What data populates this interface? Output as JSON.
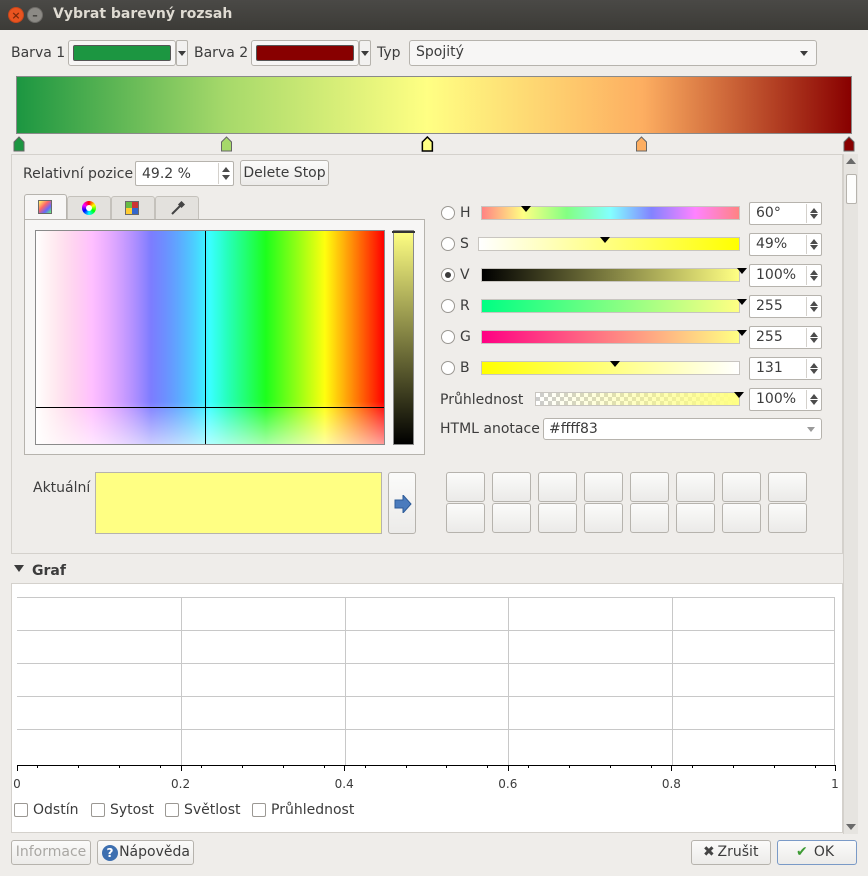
{
  "window": {
    "title": "Vybrat barevný rozsah"
  },
  "top": {
    "color1_label": "Barva 1",
    "color1": "#1c9641",
    "color2_label": "Barva 2",
    "color2": "#880000",
    "type_label": "Typ",
    "type_value": "Spojitý"
  },
  "gradient": {
    "stops": [
      "#1c9641",
      "#a6d96a",
      "#ffff83",
      "#fdae61",
      "#880000"
    ]
  },
  "position": {
    "label": "Relativní pozice",
    "value": "49.2 %",
    "delete_label": "Delete Stop"
  },
  "picker": {
    "tabs": [
      "palette-icon",
      "color-wheel-icon",
      "swatch-grid-icon",
      "eyedropper-icon"
    ],
    "channels": [
      {
        "key": "H",
        "value": "60°",
        "selected": false
      },
      {
        "key": "S",
        "value": "49%",
        "selected": false
      },
      {
        "key": "V",
        "value": "100%",
        "selected": true
      },
      {
        "key": "R",
        "value": "255",
        "selected": false
      },
      {
        "key": "G",
        "value": "255",
        "selected": false
      },
      {
        "key": "B",
        "value": "131",
        "selected": false
      }
    ],
    "opacity_label": "Průhlednost",
    "opacity_value": "100%",
    "html_label": "HTML anotace",
    "html_value": "#ffff83",
    "current_label": "Aktuální",
    "current_color": "#ffff83"
  },
  "graph": {
    "section_label": "Graf",
    "x_ticks": [
      "0",
      "0.2",
      "0.4",
      "0.6",
      "0.8",
      "1"
    ],
    "checks": [
      "Odstín",
      "Sytost",
      "Světlost",
      "Průhlednost"
    ]
  },
  "footer": {
    "info_label": "Informace",
    "help_label": "Nápověda",
    "cancel_label": "Zrušit",
    "ok_label": "OK"
  }
}
